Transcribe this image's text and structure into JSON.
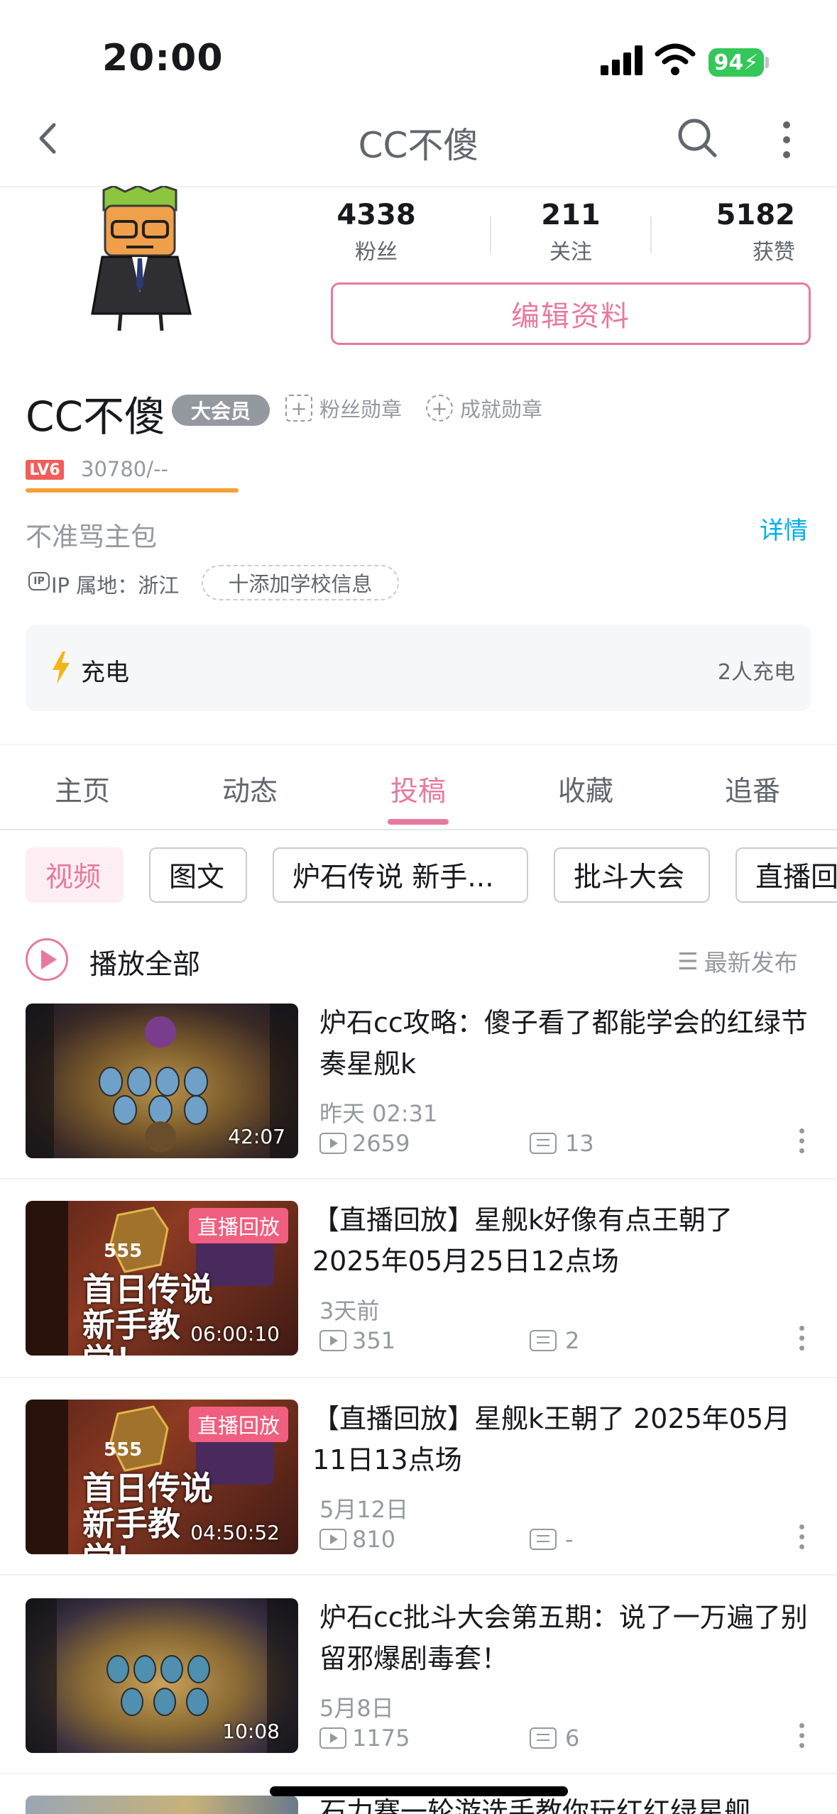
{
  "status_bar": {
    "time": "20:00",
    "battery": "94"
  },
  "nav": {
    "title": "CC不傻"
  },
  "profile": {
    "stats": [
      {
        "value": "4338",
        "label": "粉丝"
      },
      {
        "value": "211",
        "label": "关注"
      },
      {
        "value": "5182",
        "label": "获赞"
      }
    ],
    "edit_label": "编辑资料",
    "name": "CC不傻",
    "vip_label": "大会员",
    "fan_medal": "粉丝勋章",
    "achievement_medal": "成就勋章",
    "level_label": "LV6",
    "exp_text": "30780/--",
    "exp_fraction": 1.0,
    "signature": "不准骂主包",
    "detail_label": "详情",
    "ip_icon": "IP",
    "ip_text": "IP 属地：浙江",
    "school_label": "十添加学校信息",
    "charge_label": "充电",
    "charge_count": "2人充电"
  },
  "tabs": [
    {
      "label": "主页"
    },
    {
      "label": "动态"
    },
    {
      "label": "投稿",
      "active": true
    },
    {
      "label": "收藏"
    },
    {
      "label": "追番"
    }
  ],
  "filters": [
    "视频",
    "图文",
    "炉石传说 新手...",
    "批斗大会",
    "直播回"
  ],
  "play_all": "播放全部",
  "sort_label": "最新发布",
  "videos": [
    {
      "title": "炉石cc攻略：傻子看了都能学会的红绿节奏星舰k",
      "date": "昨天 02:31",
      "plays": "2659",
      "comments": "13",
      "duration": "42:07"
    },
    {
      "title": "【直播回放】星舰k好像有点王朝了 2025年05月25日12点场",
      "date": "3天前",
      "plays": "351",
      "comments": "2",
      "duration": "06:00:10",
      "tag": "直播回放",
      "overlay_num": "555",
      "overlay_text": "首日传说新手教学！"
    },
    {
      "title": "【直播回放】星舰k王朝了 2025年05月11日13点场",
      "date": "5月12日",
      "plays": "810",
      "comments": "-",
      "duration": "04:50:52",
      "tag": "直播回放",
      "overlay_num": "555",
      "overlay_text": "首日传说新手教学！"
    },
    {
      "title": "炉石cc批斗大会第五期：说了一万遍了别留邪爆剧毒套！",
      "date": "5月8日",
      "plays": "1175",
      "comments": "6",
      "duration": "10:08"
    },
    {
      "title": "石力赛一轮游选手教你玩红红绿星舰",
      "date": "",
      "plays": "",
      "comments": "",
      "duration": ""
    }
  ],
  "colors": {
    "accent": "#e7799f",
    "link": "#00aeec",
    "muted": "#9499a0",
    "battery": "#34c759"
  }
}
